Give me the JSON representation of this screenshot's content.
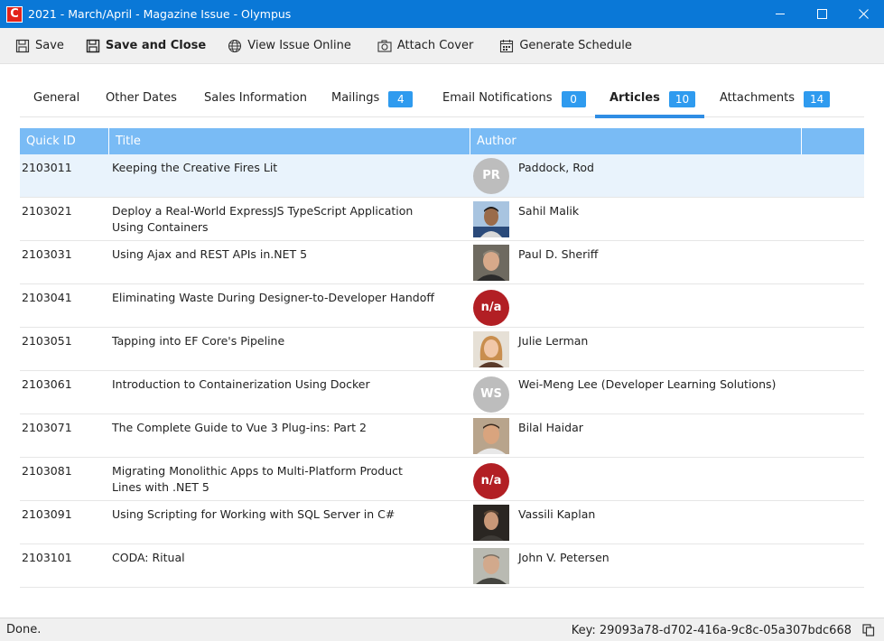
{
  "window": {
    "logo_letter": "C",
    "title": "2021 - March/April - Magazine Issue - Olympus",
    "controls": [
      "minimize-icon",
      "maximize-icon",
      "close-icon"
    ]
  },
  "toolbar": {
    "save": "Save",
    "save_close": "Save and Close",
    "view_online": "View Issue Online",
    "attach_cover": "Attach Cover",
    "generate_schedule": "Generate Schedule"
  },
  "tabs": [
    {
      "label": "General",
      "badge": null
    },
    {
      "label": "Other Dates",
      "badge": null
    },
    {
      "label": "Sales Information",
      "badge": null
    },
    {
      "label": "Mailings",
      "badge": "4"
    },
    {
      "label": "Email Notifications",
      "badge": "0"
    },
    {
      "label": "Articles",
      "badge": "10",
      "active": true
    },
    {
      "label": "Attachments",
      "badge": "14"
    }
  ],
  "grid": {
    "headers": {
      "quick_id": "Quick ID",
      "title": "Title",
      "author": "Author"
    },
    "rows": [
      {
        "id": "2103011",
        "title": "Keeping the Creative Fires Lit",
        "author": "Paddock, Rod",
        "avatar": "PR",
        "avatar_type": "initials-gray"
      },
      {
        "id": "2103021",
        "title": "Deploy a Real-World ExpressJS TypeScript Application Using Containers",
        "author": "Sahil Malik",
        "avatar": "photo",
        "avatar_type": "photo"
      },
      {
        "id": "2103031",
        "title": "Using Ajax and REST APIs in.NET 5",
        "author": "Paul D. Sheriff",
        "avatar": "photo",
        "avatar_type": "photo"
      },
      {
        "id": "2103041",
        "title": "Eliminating Waste During Designer-to-Developer Handoff",
        "author": "",
        "avatar": "n/a",
        "avatar_type": "initials-red"
      },
      {
        "id": "2103051",
        "title": "Tapping into EF Core's Pipeline",
        "author": "Julie Lerman",
        "avatar": "photo",
        "avatar_type": "photo"
      },
      {
        "id": "2103061",
        "title": "Introduction to Containerization Using Docker",
        "author": "Wei-Meng Lee (Developer Learning Solutions)",
        "avatar": "WS",
        "avatar_type": "initials-gray"
      },
      {
        "id": "2103071",
        "title": "The Complete Guide to Vue 3 Plug-ins: Part 2",
        "author": "Bilal Haidar",
        "avatar": "photo",
        "avatar_type": "photo"
      },
      {
        "id": "2103081",
        "title": "Migrating Monolithic Apps to Multi-Platform Product Lines with .NET 5",
        "author": "",
        "avatar": "n/a",
        "avatar_type": "initials-red"
      },
      {
        "id": "2103091",
        "title": "Using Scripting for Working with SQL Server in C#",
        "author": "Vassili Kaplan",
        "avatar": "photo",
        "avatar_type": "photo"
      },
      {
        "id": "2103101",
        "title": "CODA: Ritual",
        "author": "John V. Petersen",
        "avatar": "photo",
        "avatar_type": "photo"
      }
    ]
  },
  "status": {
    "left": "Done.",
    "key": "Key: 29093a78-d702-416a-9c8c-05a307bdc668"
  },
  "colors": {
    "titlebar": "#0a78d7",
    "badge": "#2f9bef",
    "grid_header": "#79bbf5",
    "selected_row": "#e9f3fc",
    "na_avatar": "#b21f24"
  }
}
